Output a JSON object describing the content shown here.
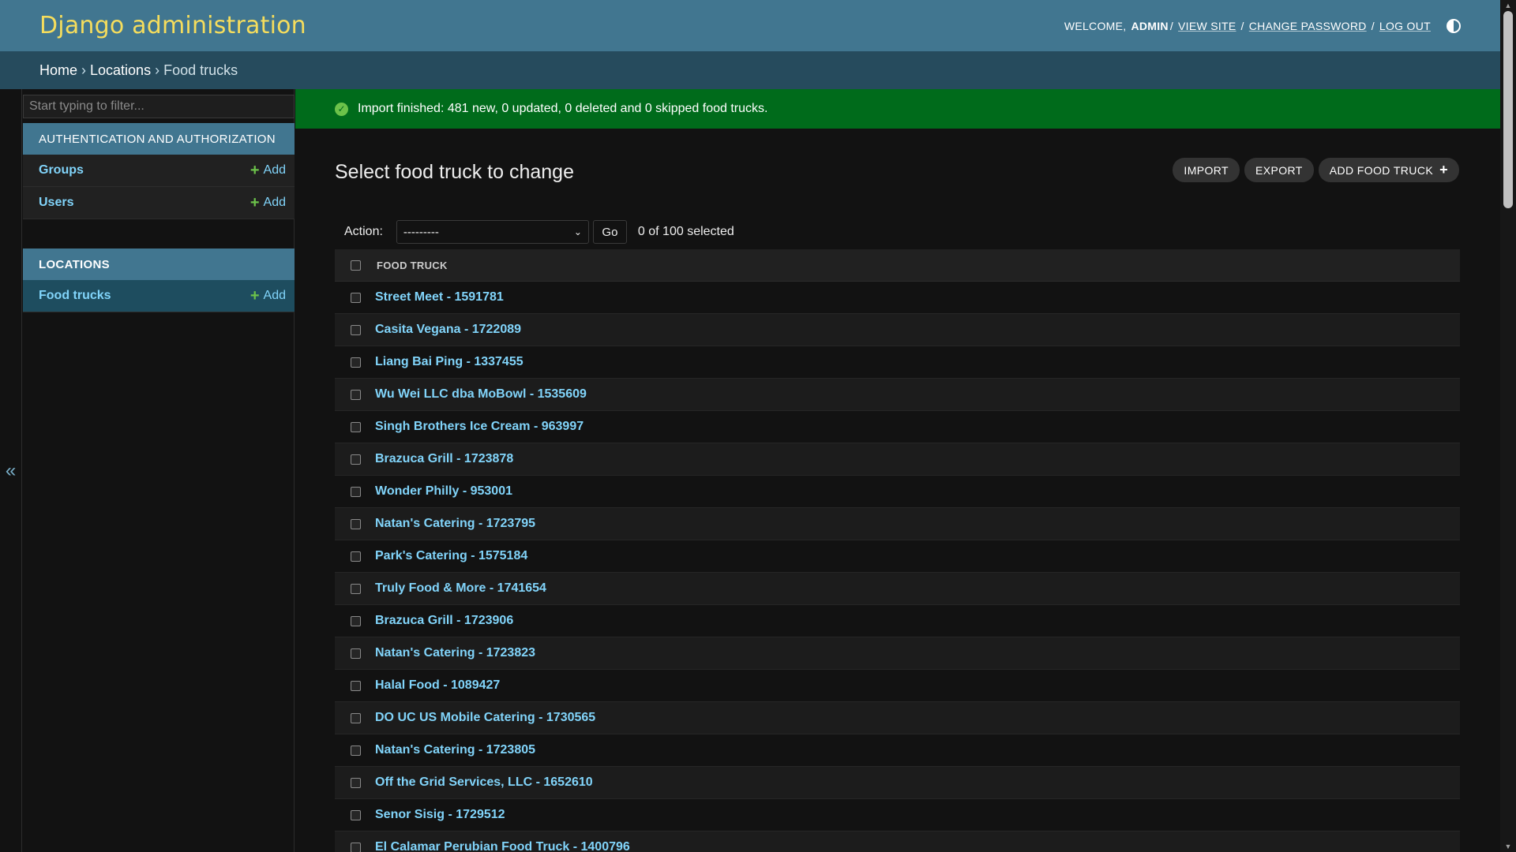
{
  "header": {
    "branding": "Django administration",
    "welcome": "WELCOME,",
    "username": "ADMIN",
    "view_site": "VIEW SITE",
    "change_password": "CHANGE PASSWORD",
    "log_out": "LOG OUT",
    "separator": "/",
    "theme_icon": "theme-toggle-icon"
  },
  "breadcrumbs": {
    "home": "Home",
    "locations": "Locations",
    "current": "Food trucks",
    "separator": "›"
  },
  "sidebar": {
    "collapse_label": "«",
    "filter_placeholder": "Start typing to filter...",
    "apps": [
      {
        "caption": "AUTHENTICATION AND AUTHORIZATION",
        "models": [
          {
            "label": "Groups",
            "add": "Add"
          },
          {
            "label": "Users",
            "add": "Add"
          }
        ]
      },
      {
        "caption": "LOCATIONS",
        "models": [
          {
            "label": "Food trucks",
            "add": "Add"
          }
        ]
      }
    ]
  },
  "message": {
    "text": "Import finished: 481 new, 0 updated, 0 deleted and 0 skipped food trucks.",
    "icon": "success-check-icon",
    "color": "#006b1b"
  },
  "content": {
    "title": "Select food truck to change",
    "tools": {
      "import": "IMPORT",
      "export": "EXPORT",
      "add": "ADD FOOD TRUCK"
    },
    "actions": {
      "label": "Action:",
      "selected": "---------",
      "go": "Go",
      "counter": "0 of 100 selected"
    },
    "table": {
      "header": "FOOD TRUCK",
      "rows": [
        "Street Meet - 1591781",
        "Casita Vegana - 1722089",
        "Liang Bai Ping - 1337455",
        "Wu Wei LLC dba MoBowl - 1535609",
        "Singh Brothers Ice Cream - 963997",
        "Brazuca Grill - 1723878",
        "Wonder Philly - 953001",
        "Natan's Catering - 1723795",
        "Park's Catering - 1575184",
        "Truly Food & More - 1741654",
        "Brazuca Grill - 1723906",
        "Natan's Catering - 1723823",
        "Halal Food - 1089427",
        "DO UC US Mobile Catering - 1730565",
        "Natan's Catering - 1723805",
        "Off the Grid Services, LLC - 1652610",
        "Senor Sisig - 1729512",
        "El Calamar Perubian Food Truck - 1400796"
      ]
    }
  },
  "colors": {
    "header_bg": "#417690",
    "branding": "#f5dd5d",
    "breadcrumbs_bg": "#264b5d",
    "link": "#81d4fa",
    "add_plus": "#6cc24a",
    "body_bg": "#121212"
  }
}
